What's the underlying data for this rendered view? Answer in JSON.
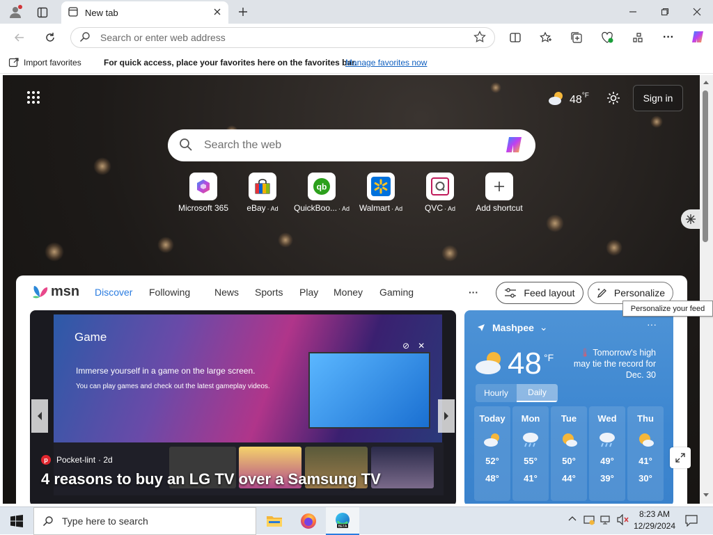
{
  "browser": {
    "tab_title": "New tab",
    "address_placeholder": "Search or enter web address"
  },
  "favorites_bar": {
    "import_label": "Import favorites",
    "message": "For quick access, place your favorites here on the favorites bar.",
    "manage_link": "Manage favorites now"
  },
  "ntp": {
    "weather_temp": "48",
    "weather_unit": "°F",
    "sign_in": "Sign in",
    "search_placeholder": "Search the web",
    "shortcuts": [
      {
        "label": "Microsoft 365",
        "ad": ""
      },
      {
        "label": "eBay",
        "ad": "· Ad"
      },
      {
        "label": "QuickBoo...",
        "ad": "· Ad"
      },
      {
        "label": "Walmart",
        "ad": "· Ad"
      },
      {
        "label": "QVC",
        "ad": "· Ad"
      },
      {
        "label": "Add shortcut",
        "ad": ""
      }
    ]
  },
  "feed": {
    "brand": "msn",
    "nav": [
      "Discover",
      "Following",
      "News",
      "Sports",
      "Play",
      "Money",
      "Gaming"
    ],
    "more": "···",
    "feed_layout": "Feed layout",
    "personalize": "Personalize",
    "tooltip": "Personalize your feed",
    "hero": {
      "game_label": "Game",
      "overlay_line1": "Immerse yourself in a game on the large screen.",
      "overlay_line2": "You can play games and check out the latest gameplay videos.",
      "source": "Pocket-lint",
      "age": "· 2d",
      "headline": "4 reasons to buy an LG TV over a Samsung TV"
    },
    "weather": {
      "location": "Mashpee",
      "temp": "48",
      "unit": "°F",
      "note": "Tomorrow's high may tie the record for Dec. 30",
      "tabs": [
        "Hourly",
        "Daily"
      ],
      "selected_tab": "Daily",
      "days": [
        {
          "name": "Today",
          "hi": "52°",
          "lo": "48°",
          "icon": "partly-cloudy-icon"
        },
        {
          "name": "Mon",
          "hi": "55°",
          "lo": "41°",
          "icon": "rain-icon"
        },
        {
          "name": "Tue",
          "hi": "50°",
          "lo": "44°",
          "icon": "partly-sunny-icon"
        },
        {
          "name": "Wed",
          "hi": "49°",
          "lo": "39°",
          "icon": "rain-icon"
        },
        {
          "name": "Thu",
          "hi": "41°",
          "lo": "30°",
          "icon": "partly-sunny-icon"
        }
      ]
    }
  },
  "taskbar": {
    "search_placeholder": "Type here to search",
    "time": "8:23 AM",
    "date": "12/29/2024"
  },
  "colors": {
    "accent": "#2a7ce0",
    "weather_card": "#4e93d6",
    "taskbar": "#dfe6ee"
  }
}
